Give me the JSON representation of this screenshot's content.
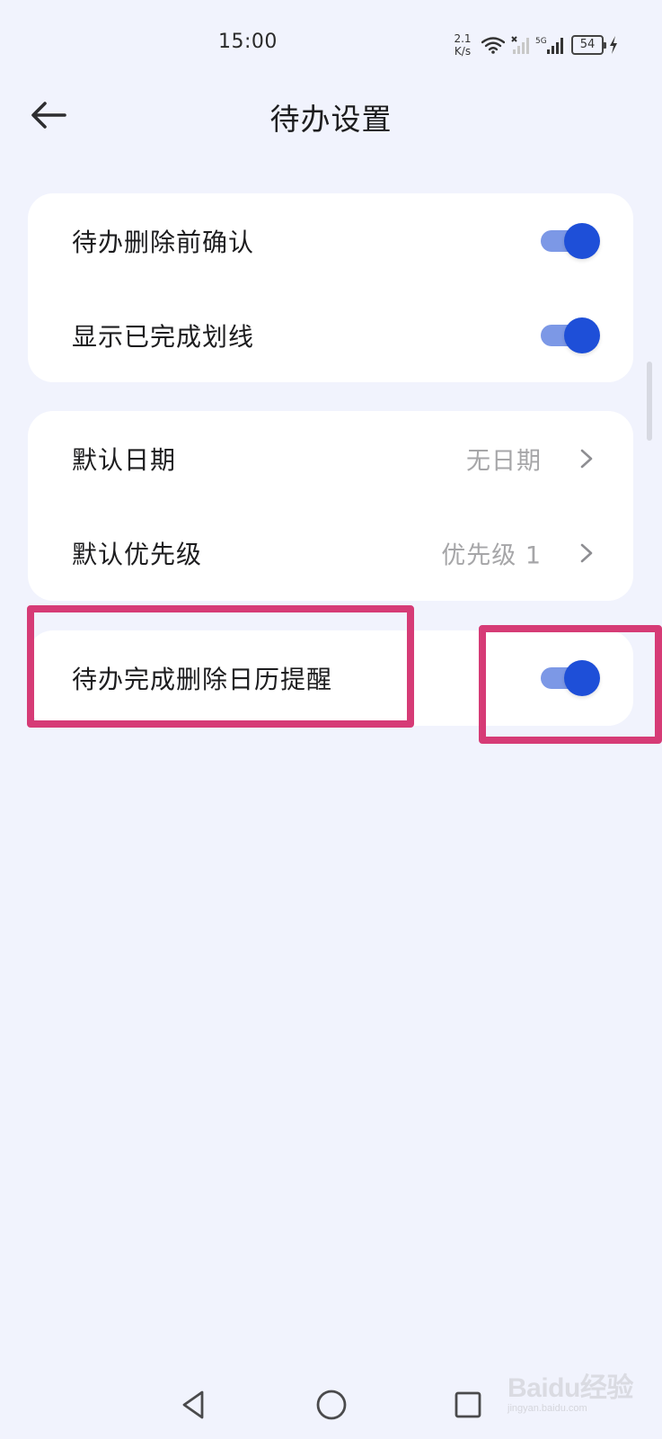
{
  "status_bar": {
    "time": "15:00",
    "net_speed_value": "2.1",
    "net_speed_unit": "K/s",
    "network_label": "5G",
    "battery_level": "54",
    "icons": [
      "wifi-icon",
      "signal-x-icon",
      "signal-5g-icon",
      "battery-icon",
      "charging-bolt-icon"
    ]
  },
  "header": {
    "title": "待办设置",
    "back_icon": "arrow-left-icon"
  },
  "sections": [
    {
      "rows": [
        {
          "label": "待办删除前确认",
          "type": "toggle",
          "checked": true
        },
        {
          "label": "显示已完成划线",
          "type": "toggle",
          "checked": true
        }
      ]
    },
    {
      "rows": [
        {
          "label": "默认日期",
          "type": "select",
          "value": "无日期",
          "icon": "chevron-right-icon"
        },
        {
          "label": "默认优先级",
          "type": "select",
          "value": "优先级 1",
          "icon": "chevron-right-icon"
        }
      ]
    },
    {
      "rows": [
        {
          "label": "待办完成删除日历提醒",
          "type": "toggle",
          "checked": true
        }
      ]
    }
  ],
  "annotation": {
    "highlight_color": "#d63b76"
  },
  "nav_bar": {
    "icons": [
      "nav-back-triangle-icon",
      "nav-home-circle-icon",
      "nav-recents-square-icon"
    ]
  },
  "watermark": {
    "text": "Baidu经验",
    "subtext": "jingyan.baidu.com"
  },
  "colors": {
    "background": "#f1f3fd",
    "card": "#ffffff",
    "toggle_knob": "#1e4fd8",
    "toggle_track": "#7c98e6",
    "secondary_text": "#a6a6a8"
  }
}
